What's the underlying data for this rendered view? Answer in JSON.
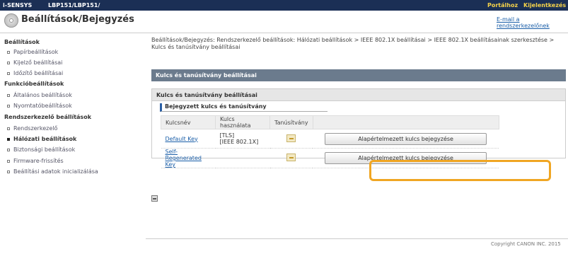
{
  "topbar": {
    "brand": "i-SENSYS",
    "model": "LBP151/LBP151/",
    "portal_link": "Portálhoz",
    "logout": "Kijelentkezés"
  },
  "title": {
    "page_title": "Beállítások/Bejegyzés",
    "email_link": "E-mail a rendszerkezelőnek"
  },
  "sidebar": {
    "items": [
      {
        "label": "Beállítások",
        "type": "section"
      },
      {
        "label": "Papírbeállítások",
        "type": "sub"
      },
      {
        "label": "Kijelző beállításai",
        "type": "sub"
      },
      {
        "label": "Időzítő beállításai",
        "type": "sub"
      },
      {
        "label": "Funkcióbeállítások",
        "type": "section"
      },
      {
        "label": "Általános beállítások",
        "type": "sub"
      },
      {
        "label": "Nyomtatóbeállítások",
        "type": "sub"
      },
      {
        "label": "Rendszerkezelő beállítások",
        "type": "section"
      },
      {
        "label": "Rendszerkezelő",
        "type": "sub"
      },
      {
        "label": "Hálózati beállítások",
        "type": "sub",
        "active": true
      },
      {
        "label": "Biztonsági beállítások",
        "type": "sub"
      },
      {
        "label": "Firmware-frissítés",
        "type": "sub"
      },
      {
        "label": "Beállítási adatok inicializálása",
        "type": "sub"
      }
    ]
  },
  "main": {
    "breadcrumb": "Beállítások/Bejegyzés: Rendszerkezelő beállítások: Hálózati beállítások > IEEE 802.1X beállításai > IEEE 802.1X beállításainak szerkesztése > Kulcs és tanúsítvány beállításai",
    "section_header": "Kulcs és tanúsítvány beállításai",
    "panel_title": "Kulcs és tanúsítvány beállításai",
    "registered_title": "Bejegyzett kulcs és tanúsítvány",
    "table": {
      "headers": [
        "Kulcsnév",
        "Kulcs használata",
        "Tanúsítvány",
        ""
      ],
      "rows": [
        {
          "key_name": "Default Key",
          "usage_line1": "[TLS]",
          "usage_line2": "[IEEE 802.1X]",
          "button": "Alapértelmezett kulcs bejegyzése"
        },
        {
          "key_name": "Self-Regenerated Key",
          "usage_line1": "",
          "usage_line2": "",
          "button": "Alapértelmezett kulcs bejegyzése"
        }
      ]
    },
    "copyright": "Copyright CANON INC. 2015"
  },
  "colors": {
    "topbar": "#1b2f55",
    "section_header": "#6b7b8d",
    "highlight": "#f0a623",
    "link": "#1a5ea8"
  }
}
